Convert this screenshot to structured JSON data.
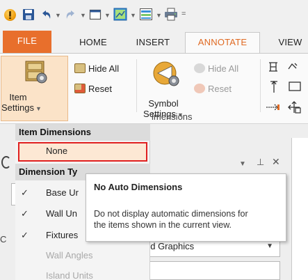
{
  "tabs": {
    "file": "FILE",
    "home": "HOME",
    "insert": "INSERT",
    "annotate": "ANNOTATE",
    "view": "VIEW"
  },
  "ribbon": {
    "item_settings": {
      "line1": "Item",
      "line2": "Settings"
    },
    "hide_all_active": "Hide All",
    "reset_active": "Reset",
    "symbol_settings": {
      "line1": "Symbol",
      "line2": "Settings"
    },
    "hide_all_disabled": "Hide All",
    "reset_disabled": "Reset",
    "group_label_partial": "imensions"
  },
  "menu": {
    "item_dimensions_header": "Item Dimensions",
    "none_item": "None",
    "dimension_types_header": "Dimension Ty",
    "items": [
      {
        "label": "Base Ur",
        "checked": true,
        "enabled": true
      },
      {
        "label": "Wall Un",
        "checked": true,
        "enabled": true
      },
      {
        "label": "Fixtures",
        "checked": true,
        "enabled": true
      },
      {
        "label": "Wall Angles",
        "checked": false,
        "enabled": false
      },
      {
        "label": "Island Units",
        "checked": false,
        "enabled": false
      }
    ]
  },
  "panel": {
    "graphics_value": "ed Graphics"
  },
  "tooltip": {
    "title": "No Auto Dimensions",
    "line1": "Do not display automatic dimensions for",
    "line2": "the items shown in the current view."
  },
  "colors": {
    "file_tab": "#e86f2c",
    "active_tab_text": "#e06a23",
    "highlight_border": "#e02020",
    "highlight_fill": "#fde8d4"
  }
}
